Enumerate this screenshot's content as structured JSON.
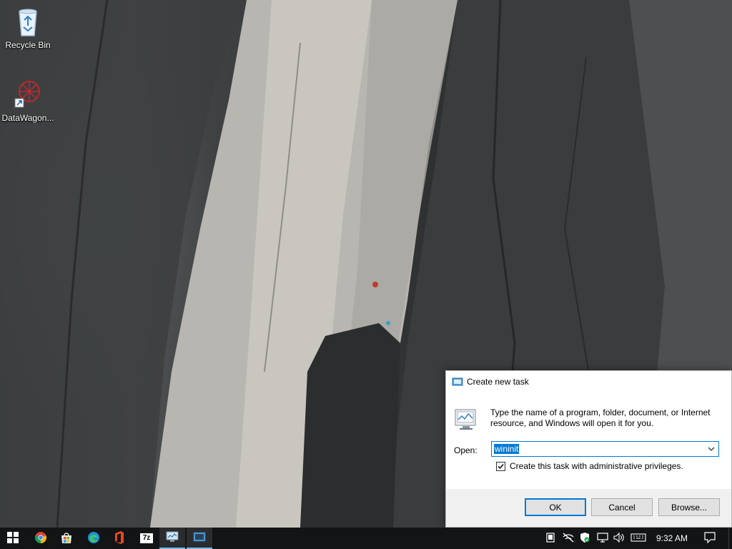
{
  "desktop": {
    "icons": [
      {
        "label": "Recycle Bin",
        "icon": "recycle-bin-icon"
      },
      {
        "label": "DataWagon...",
        "icon": "datawagon-icon"
      }
    ]
  },
  "dialog": {
    "title": "Create new task",
    "description": "Type the name of a program, folder, document, or Internet resource, and Windows will open it for you.",
    "open_label": "Open:",
    "open_value": "wininit",
    "admin_checkbox_label": "Create this task with administrative privileges.",
    "admin_checked": true,
    "buttons": {
      "ok": "OK",
      "cancel": "Cancel",
      "browse": "Browse..."
    },
    "accent": "#0078d7"
  },
  "taskbar": {
    "apps": [
      "start-icon",
      "chrome-icon",
      "store-icon",
      "edge-icon",
      "office-icon",
      "7zip-icon",
      "task-manager-icon",
      "run-dialog-icon"
    ],
    "zip_label": "7z",
    "tray_icons": [
      "tablet-icon",
      "network-muted-icon",
      "defender-icon",
      "display-icon",
      "volume-icon",
      "keyboard-icon"
    ],
    "clock": "9:32 AM",
    "notification_icon": "action-center-icon"
  }
}
